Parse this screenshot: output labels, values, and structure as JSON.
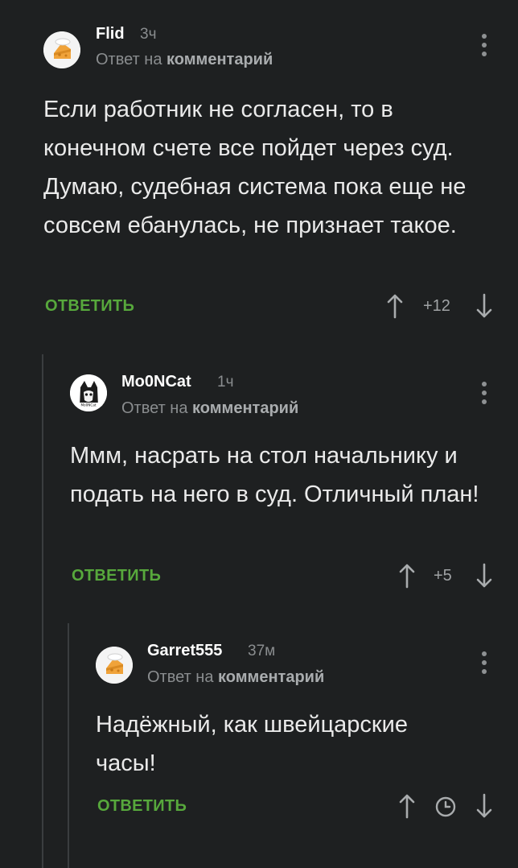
{
  "reply_to_prefix": "Ответ на",
  "reply_to_link": "комментарий",
  "comments": [
    {
      "author": "Flid",
      "time": "3ч",
      "text": "Если работник не согласен, то в конечном счете все пойдет через суд. Думаю, судебная система пока еще не совсем ебанулась, не признает такое.",
      "reply_label": "ОТВЕТИТЬ",
      "score": "+12",
      "avatar_icon": "cheese-avatar-icon"
    },
    {
      "author": "Mo0NCat",
      "time": "1ч",
      "text": "Ммм, насрать на стол начальнику и подать на него в суд. Отличный план!",
      "reply_label": "ОТВЕТИТЬ",
      "score": "+5",
      "avatar_icon": "cat-avatar-icon",
      "avatar_caption": "Mo0NCat"
    },
    {
      "author": "Garret555",
      "time": "37м",
      "text": "Надёжный, как швейцарские часы!",
      "reply_label": "ОТВЕТИТЬ",
      "score_icon": "clock-icon",
      "avatar_icon": "cheese-avatar-icon"
    }
  ],
  "colors": {
    "background": "#1e2021",
    "accent": "#57a83c",
    "muted": "#8a8d8f"
  }
}
